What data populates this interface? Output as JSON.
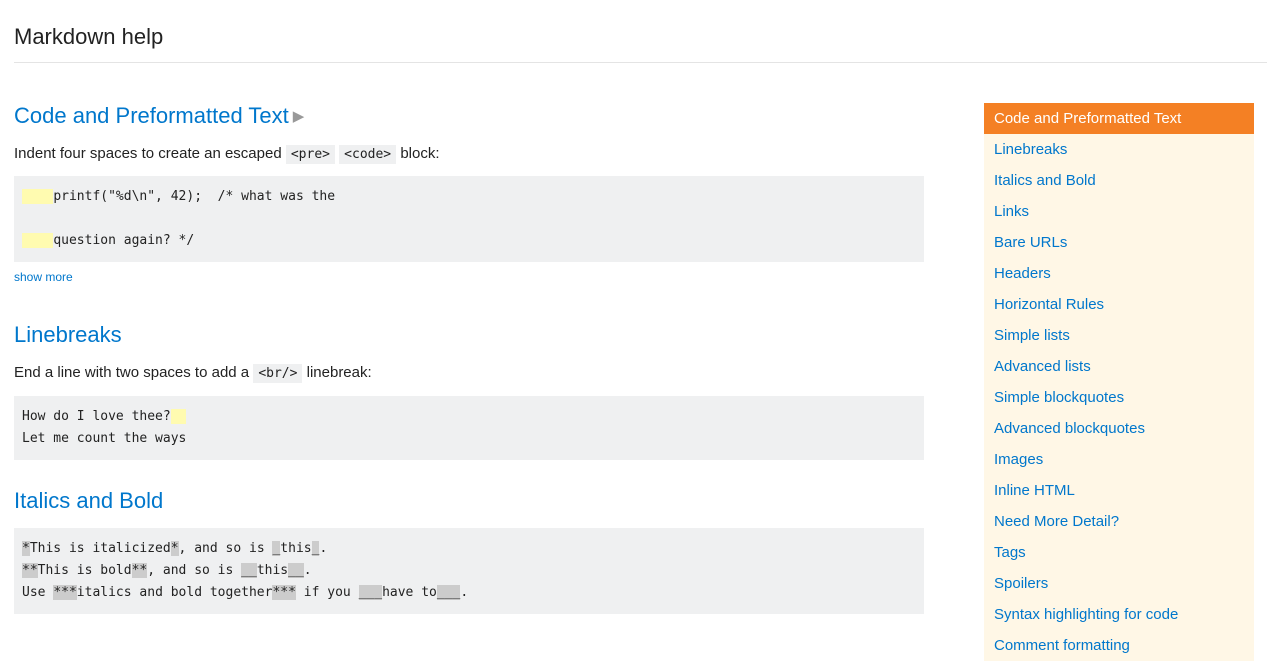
{
  "page_title": "Markdown help",
  "sections": {
    "code_pre": {
      "heading": "Code and Preformatted Text",
      "desc_before": "Indent four spaces to create an escaped ",
      "inline_pre": "<pre>",
      "inline_code": "<code>",
      "desc_after": " block:",
      "indent": "    ",
      "line1_text": "printf(\"%d\\n\", 42);  /* what was the",
      "line2_text": "question again? */",
      "show_more": "show more"
    },
    "linebreaks": {
      "heading": "Linebreaks",
      "desc_before": "End a line with two spaces to add a ",
      "inline_br": "<br/>",
      "desc_after": " linebreak:",
      "line1": "How do I love thee?",
      "trailing": "  ",
      "line2": "Let me count the ways"
    },
    "italics_bold": {
      "heading": "Italics and Bold",
      "l1_m1": "*",
      "l1_t1": "This is italicized",
      "l1_m2": "*",
      "l1_t2": ", and so is ",
      "l1_m3": "_",
      "l1_t3": "this",
      "l1_m4": "_",
      "l1_t4": ".",
      "l2_m1": "**",
      "l2_t1": "This is bold",
      "l2_m2": "**",
      "l2_t2": ", and so is ",
      "l2_m3": "__",
      "l2_t3": "this",
      "l2_m4": "__",
      "l2_t4": ".",
      "l3_t0": "Use ",
      "l3_m1": "***",
      "l3_t1": "italics and bold together",
      "l3_m2": "***",
      "l3_t2": " if you ",
      "l3_m3": "___",
      "l3_t3": "have to",
      "l3_m4": "___",
      "l3_t4": "."
    }
  },
  "toc": [
    {
      "label": "Code and Preformatted Text",
      "active": true
    },
    {
      "label": "Linebreaks",
      "active": false
    },
    {
      "label": "Italics and Bold",
      "active": false
    },
    {
      "label": "Links",
      "active": false
    },
    {
      "label": "Bare URLs",
      "active": false
    },
    {
      "label": "Headers",
      "active": false
    },
    {
      "label": "Horizontal Rules",
      "active": false
    },
    {
      "label": "Simple lists",
      "active": false
    },
    {
      "label": "Advanced lists",
      "active": false
    },
    {
      "label": "Simple blockquotes",
      "active": false
    },
    {
      "label": "Advanced blockquotes",
      "active": false
    },
    {
      "label": "Images",
      "active": false
    },
    {
      "label": "Inline HTML",
      "active": false
    },
    {
      "label": "Need More Detail?",
      "active": false
    },
    {
      "label": "Tags",
      "active": false
    },
    {
      "label": "Spoilers",
      "active": false
    },
    {
      "label": "Syntax highlighting for code",
      "active": false
    },
    {
      "label": "Comment formatting",
      "active": false
    }
  ]
}
